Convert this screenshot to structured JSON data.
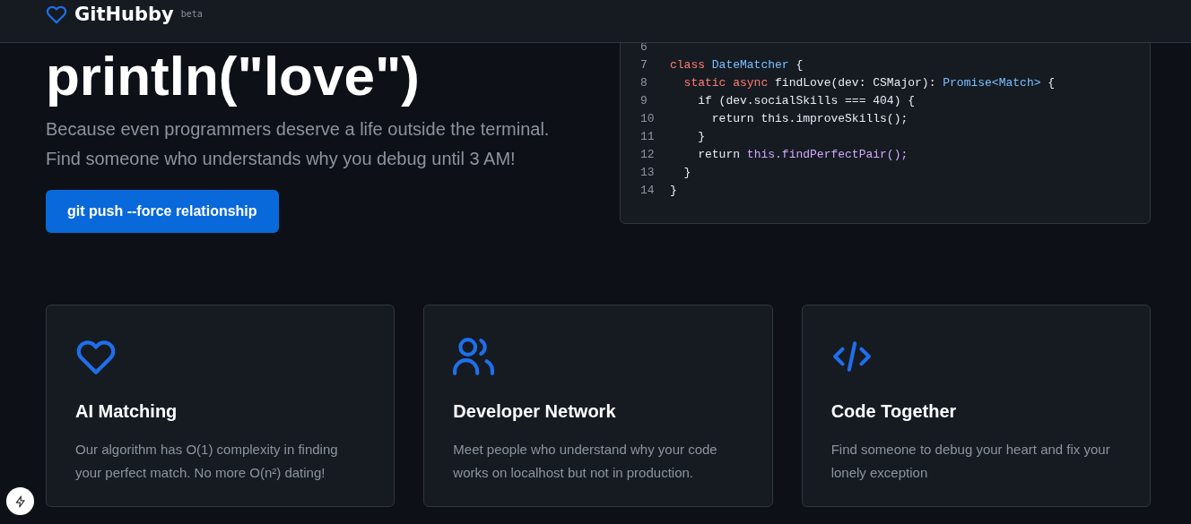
{
  "header": {
    "brand": "GitHubby",
    "badge": "beta"
  },
  "hero": {
    "headline": "println(\"love\")",
    "subtitle_lines": [
      "Because even programmers deserve a life outside the terminal.",
      "Find someone who understands why you debug until 3 AM!"
    ],
    "button": "git push --force relationship"
  },
  "code": {
    "lines": [
      {
        "number": "6"
      },
      {
        "number": "7",
        "tokens": [
          {
            "text": "class ",
            "kind": "keyword"
          },
          {
            "text": "DateMatcher",
            "kind": "type"
          },
          {
            "text": " {",
            "kind": "plain"
          }
        ]
      },
      {
        "number": "8",
        "tokens": [
          {
            "text": "  static async ",
            "kind": "keyword"
          },
          {
            "text": "findLove(dev: CSMajor): ",
            "kind": "plain"
          },
          {
            "text": "Promise<Match>",
            "kind": "type"
          },
          {
            "text": " {",
            "kind": "plain"
          }
        ]
      },
      {
        "number": "9",
        "tokens": [
          {
            "text": "    if (dev.socialSkills === 404) {",
            "kind": "plain"
          }
        ]
      },
      {
        "number": "10",
        "tokens": [
          {
            "text": "      return this.improveSkills();",
            "kind": "plain"
          }
        ]
      },
      {
        "number": "11",
        "tokens": [
          {
            "text": "    }",
            "kind": "plain"
          }
        ]
      },
      {
        "number": "12",
        "tokens": [
          {
            "text": "    return ",
            "kind": "plain"
          },
          {
            "text": "this.findPerfectPair();",
            "kind": "function"
          }
        ]
      },
      {
        "number": "13",
        "tokens": [
          {
            "text": "  }",
            "kind": "plain"
          }
        ]
      },
      {
        "number": "14",
        "tokens": [
          {
            "text": "}",
            "kind": "plain"
          }
        ]
      }
    ]
  },
  "features": [
    {
      "kind": "heart",
      "title": "AI Matching",
      "description": "Our algorithm has O(1) complexity in finding your perfect match. No more O(n²) dating!"
    },
    {
      "kind": "users",
      "title": "Developer Network",
      "description": "Meet people who understand why your code works on localhost but not in production."
    },
    {
      "kind": "code",
      "title": "Code Together",
      "description": "Find someone to debug your heart and fix your lonely exception"
    }
  ]
}
